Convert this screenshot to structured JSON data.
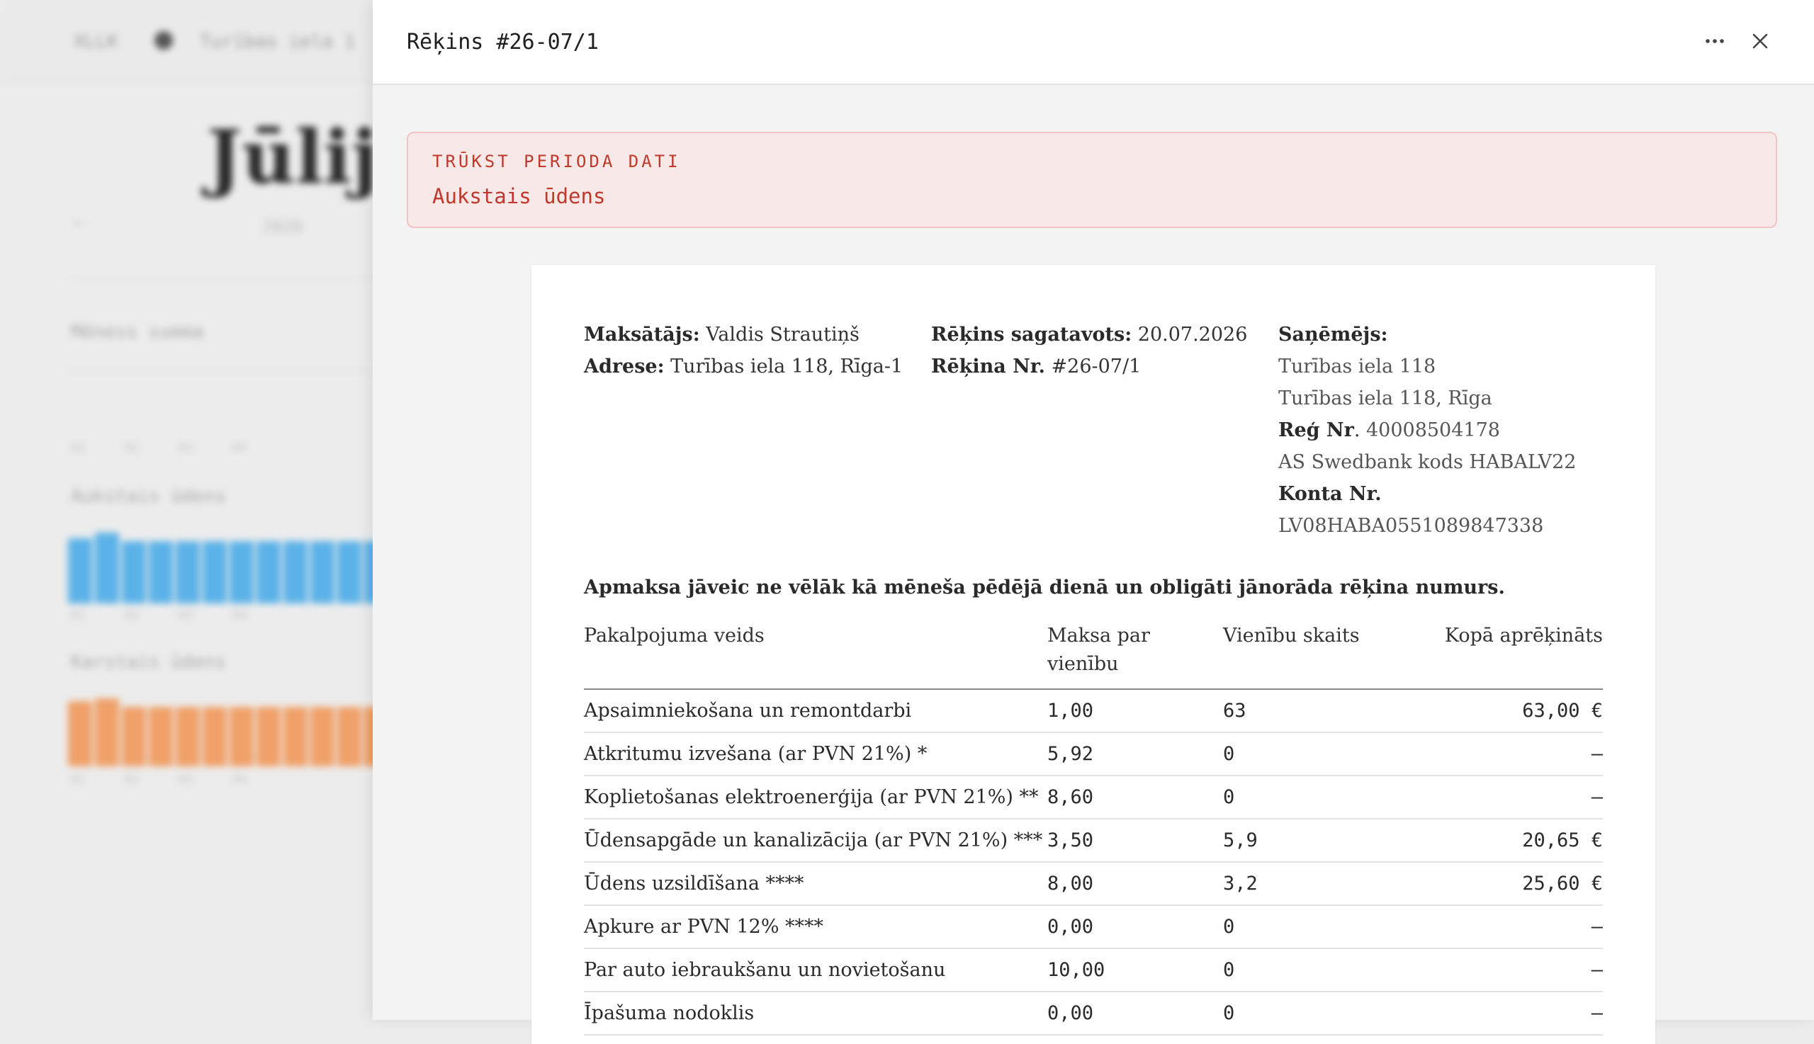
{
  "background": {
    "breadcrumb_left": "XLLK",
    "breadcrumb_right": "Turības iela 1",
    "month_title": "Jūlijs",
    "year": "2026",
    "back": "←",
    "section_label": "Mēness summa",
    "chart1_label": "Aukstais ūdens",
    "chart2_label": "Karstais ūdens",
    "tick_labels": [
      "01",
      "02",
      "03",
      "04"
    ],
    "chart1_color": "#5bb2e8",
    "chart2_color": "#f0a068"
  },
  "panel": {
    "title": "Rēķins #26-07/1",
    "more_icon": "more-horizontal-icon",
    "close_icon": "close-icon"
  },
  "alert": {
    "title": "TRŪKST PERIODA DATI",
    "body": "Aukstais ūdens"
  },
  "invoice": {
    "payer_label": "Maksātājs:",
    "payer": "Valdis Strautiņš",
    "address_label": "Adrese:",
    "address": "Turības iela 118, Rīga-1",
    "prepared_label": "Rēķins sagatavots:",
    "prepared": "20.07.2026",
    "number_label": "Rēķina Nr.",
    "number": "#26-07/1",
    "recipient_label": "Saņēmējs:",
    "recipient_name": "Turības iela 118",
    "recipient_address": "Turības iela 118, Rīga",
    "reg_label": "Reģ Nr",
    "reg": "40008504178",
    "bank": "AS Swedbank kods HABALV22",
    "account_label": "Konta Nr.",
    "account": "LV08HABA0551089847338",
    "notice": "Apmaksa jāveic ne vēlāk kā mēneša pēdējā dienā un obligāti jānorāda rēķina numurs.",
    "columns": [
      "Pakalpojuma veids",
      "Maksa par vienību",
      "Vienību skaits",
      "Kopā aprēķināts"
    ],
    "rows": [
      {
        "service": "Apsaimniekošana un remontdarbi",
        "price": "1,00",
        "units": "63",
        "total": "63,00 €"
      },
      {
        "service": "Atkritumu izvešana (ar PVN 21%) *",
        "price": "5,92",
        "units": "0",
        "total": "—"
      },
      {
        "service": "Koplietošanas elektroenerģija (ar PVN 21%) **",
        "price": "8,60",
        "units": "0",
        "total": "—"
      },
      {
        "service": "Ūdensapgāde un kanalizācija (ar PVN 21%) ***",
        "price": "3,50",
        "units": "5,9",
        "total": "20,65 €"
      },
      {
        "service": "Ūdens uzsildīšana ****",
        "price": "8,00",
        "units": "3,2",
        "total": "25,60 €"
      },
      {
        "service": "Apkure ar PVN 12% ****",
        "price": "0,00",
        "units": "0",
        "total": "—"
      },
      {
        "service": "Par auto iebraukšanu un novietošanu",
        "price": "10,00",
        "units": "0",
        "total": "—"
      },
      {
        "service": "Īpašuma nodoklis",
        "price": "0,00",
        "units": "0",
        "total": "—"
      }
    ]
  }
}
